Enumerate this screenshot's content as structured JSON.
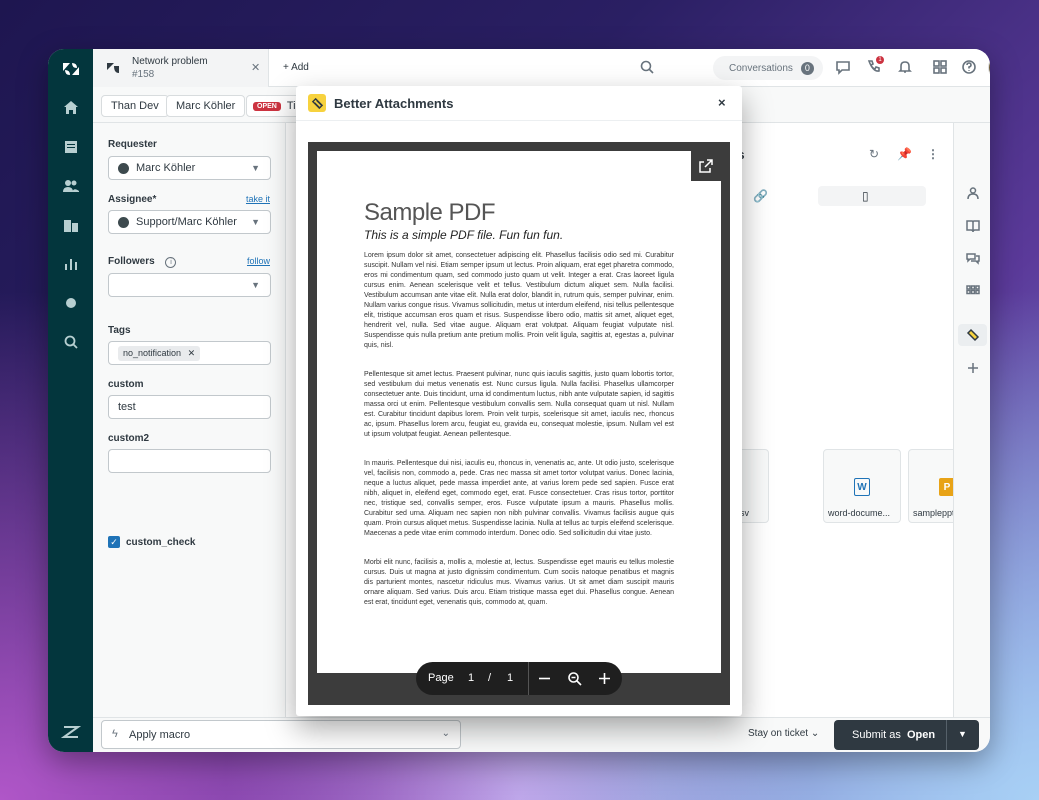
{
  "topbar": {
    "tab": {
      "title": "Network problem",
      "subtitle": "#158"
    },
    "add_label": "Add",
    "conversations_label": "Conversations",
    "conversations_count": "0",
    "notification_badge": "1"
  },
  "subbar": {
    "crumbs": [
      "Than Dev",
      "Marc Köhler"
    ],
    "status_badge": "OPEN",
    "ticket_crumb": "Ti"
  },
  "properties": {
    "requester_label": "Requester",
    "requester_value": "Marc Köhler",
    "assignee_label": "Assignee*",
    "assignee_link": "take it",
    "assignee_value": "Support/Marc Köhler",
    "followers_label": "Followers",
    "followers_link": "follow",
    "tags_label": "Tags",
    "tag_value": "no_notification",
    "custom_label": "custom",
    "custom_value": "test",
    "custom2_label": "custom2",
    "custom2_value": "",
    "custom_check_label": "custom_check"
  },
  "context": {
    "title_fragment": "ts",
    "files": [
      {
        "name": "sv"
      },
      {
        "name": "word-docume...",
        "icon": "W"
      },
      {
        "name": "samplepptx.pp...",
        "icon": "P"
      }
    ]
  },
  "bottombar": {
    "macro_label": "Apply macro",
    "stay_label": "Stay on ticket",
    "submit_label": "Submit as",
    "submit_status": "Open"
  },
  "modal": {
    "title": "Better Attachments",
    "close_symbol": "×"
  },
  "pdf": {
    "title": "Sample PDF",
    "subtitle": "This is a simple PDF file. Fun fun fun.",
    "paragraphs": [
      "Lorem ipsum dolor sit amet, consectetuer adipiscing elit. Phasellus facilisis odio sed mi. Curabitur suscipit. Nullam vel nisi. Etiam semper ipsum ut lectus. Proin aliquam, erat eget pharetra commodo, eros mi condimentum quam, sed commodo justo quam ut velit. Integer a erat. Cras laoreet ligula cursus enim. Aenean scelerisque velit et tellus. Vestibulum dictum aliquet sem. Nulla facilisi. Vestibulum accumsan ante vitae elit. Nulla erat dolor, blandit in, rutrum quis, semper pulvinar, enim. Nullam varius congue risus. Vivamus sollicitudin, metus ut interdum eleifend, nisi tellus pellentesque elit, tristique accumsan eros quam et risus. Suspendisse libero odio, mattis sit amet, aliquet eget, hendrerit vel, nulla. Sed vitae augue. Aliquam erat volutpat. Aliquam feugiat vulputate nisl. Suspendisse quis nulla pretium ante pretium mollis. Proin velit ligula, sagittis at, egestas a, pulvinar quis, nisl.",
      "Pellentesque sit amet lectus. Praesent pulvinar, nunc quis iaculis sagittis, justo quam lobortis tortor, sed vestibulum dui metus venenatis est. Nunc cursus ligula. Nulla facilisi. Phasellus ullamcorper consectetuer ante. Duis tincidunt, urna id condimentum luctus, nibh ante vulputate sapien, id sagittis massa orci ut enim. Pellentesque vestibulum convallis sem. Nulla consequat quam ut nisl. Nullam est. Curabitur tincidunt dapibus lorem. Proin velit turpis, scelerisque sit amet, iaculis nec, rhoncus ac, ipsum. Phasellus lorem arcu, feugiat eu, gravida eu, consequat molestie, ipsum. Nullam vel est ut ipsum volutpat feugiat. Aenean pellentesque.",
      "In mauris. Pellentesque dui nisi, iaculis eu, rhoncus in, venenatis ac, ante. Ut odio justo, scelerisque vel, facilisis non, commodo a, pede. Cras nec massa sit amet tortor volutpat varius. Donec lacinia, neque a luctus aliquet, pede massa imperdiet ante, at varius lorem pede sed sapien. Fusce erat nibh, aliquet in, eleifend eget, commodo eget, erat. Fusce consectetuer. Cras risus tortor, porttitor nec, tristique sed, convallis semper, eros. Fusce vulputate ipsum a mauris. Phasellus mollis. Curabitur sed urna. Aliquam nec sapien non nibh pulvinar convallis. Vivamus facilisis augue quis quam. Proin cursus aliquet metus. Suspendisse lacinia. Nulla at tellus ac turpis eleifend scelerisque. Maecenas a pede vitae enim commodo interdum. Donec odio. Sed sollicitudin dui vitae justo.",
      "Morbi elit nunc, facilisis a, mollis a, molestie at, lectus. Suspendisse eget mauris eu tellus molestie cursus. Duis ut magna at justo dignissim condimentum. Cum sociis natoque penatibus et magnis dis parturient montes, nascetur ridiculus mus. Vivamus varius. Ut sit amet diam suscipit mauris ornare aliquam. Sed varius. Duis arcu. Etiam tristique massa eget dui. Phasellus congue. Aenean est erat, tincidunt eget, venenatis quis, commodo at, quam."
    ]
  },
  "pager": {
    "page_label": "Page",
    "current": "1",
    "separator": "/",
    "total": "1"
  },
  "colors": {
    "nav_bg": "#03363d",
    "accent_blue": "#1f73b7",
    "open_badge": "#cc3340",
    "submit_bg": "#2f3941",
    "logo_yellow": "#f7d23e"
  }
}
